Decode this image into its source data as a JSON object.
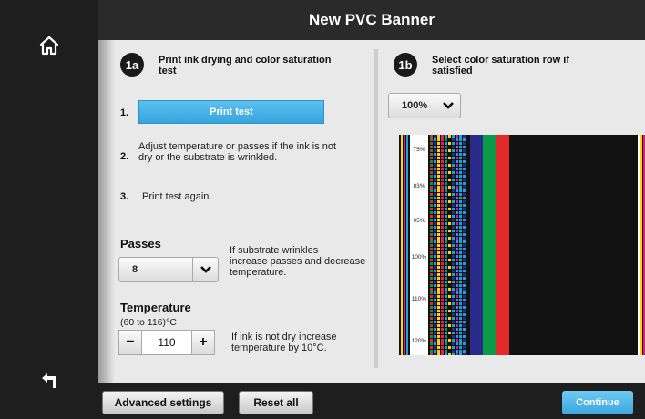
{
  "header": {
    "title": "New PVC Banner"
  },
  "sidebar": {
    "home_icon": "home-icon",
    "back_icon": "back-icon"
  },
  "step_a": {
    "badge": "1a",
    "title_line1": "Print ink drying and color saturation",
    "title_line2": "test",
    "steps": [
      {
        "num": "1.",
        "button_label": "Print test"
      },
      {
        "num": "2.",
        "line1": "Adjust temperature or passes if the ink is not",
        "line2": "dry or the substrate is wrinkled."
      },
      {
        "num": "3.",
        "text": "Print test again."
      }
    ],
    "passes": {
      "label": "Passes",
      "value": "8",
      "hint_line1": "If substrate wrinkles",
      "hint_line2": "increase passes and decrease",
      "hint_line3": "temperature."
    },
    "temperature": {
      "label": "Temperature",
      "range": "(60 to 116)°C",
      "value": "110",
      "minus": "−",
      "plus": "+",
      "hint_line1": "If ink is not dry increase",
      "hint_line2": "temperature by 10°C."
    }
  },
  "step_b": {
    "badge": "1b",
    "title_line1": "Select color saturation row if",
    "title_line2": "satisfied",
    "saturation_select": "100%",
    "rows": [
      "75%",
      "83%",
      "95%",
      "100%",
      "110%",
      "120%"
    ]
  },
  "footer": {
    "advanced_label": "Advanced settings",
    "reset_label": "Reset all",
    "continue_label": "Continue"
  },
  "colors": {
    "accent": "#3aa7de",
    "dark": "#1e1e1e",
    "panel": "#e9e9e9"
  }
}
